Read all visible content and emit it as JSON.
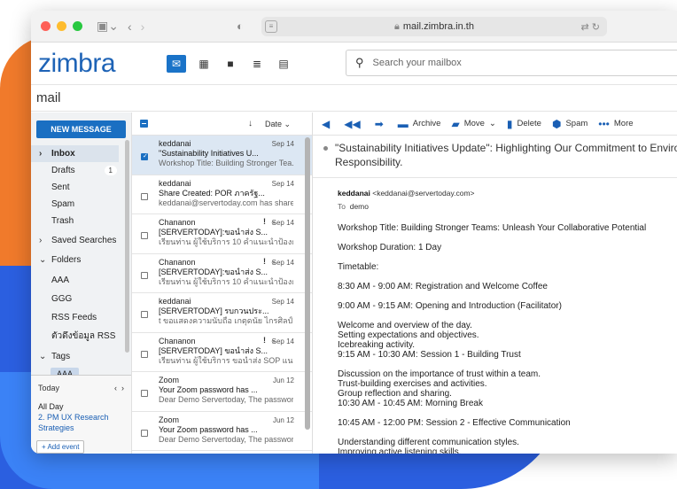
{
  "browser": {
    "url": "mail.zimbra.in.th"
  },
  "app": {
    "logo": "zimbra",
    "mode": "mail",
    "search_placeholder": "Search your mailbox"
  },
  "sidebar": {
    "new_message": "NEW MESSAGE",
    "inbox": "Inbox",
    "drafts": "Drafts",
    "drafts_count": "1",
    "sent": "Sent",
    "spam": "Spam",
    "trash": "Trash",
    "saved_searches": "Saved Searches",
    "folders": "Folders",
    "folder_items": [
      "AAA",
      "GGG",
      "RSS Feeds",
      "ตัวดึงข้อมูล RSS"
    ],
    "tags": "Tags",
    "tag_items": [
      "AAA"
    ]
  },
  "calendar": {
    "today": "Today",
    "all_day": "All Day",
    "event": "2. PM UX Research Strategies",
    "add_event": "+ Add event"
  },
  "list": {
    "sort_label": "Date",
    "messages": [
      {
        "from": "keddanai",
        "date": "Sep 14",
        "subject": "\"Sustainability Initiatives U...",
        "preview": "Workshop Title: Building Stronger Tea...",
        "selected": true,
        "flag": false
      },
      {
        "from": "keddanai",
        "date": "Sep 14",
        "subject": "Share Created: POR ภาครัฐ...",
        "preview": "keddanai@servertoday.com has share...",
        "selected": false,
        "flag": false
      },
      {
        "from": "Chananon",
        "date": "Sep 14",
        "subject": "[SERVERTODAY]:ขอนำส่ง S...",
        "preview": "เรียนท่าน ผู้ใช้บริการ 10 คำแนะนำป้องกัน...",
        "selected": false,
        "flag": true
      },
      {
        "from": "Chananon",
        "date": "Sep 14",
        "subject": "[SERVERTODAY]:ขอนำส่ง S...",
        "preview": "เรียนท่าน ผู้ใช้บริการ 10 คำแนะนำป้องกัน...",
        "selected": false,
        "flag": true
      },
      {
        "from": "keddanai",
        "date": "Sep 14",
        "subject": "[SERVERTODAY] รบกวนประ...",
        "preview": "t ขอแสดงความนับถือ เกตุดนัย ไกรศิลป์ ...",
        "selected": false,
        "flag": false
      },
      {
        "from": "Chananon",
        "date": "Sep 14",
        "subject": "[SERVERTODAY] ขอนำส่ง S...",
        "preview": "เรียนท่าน ผู้ใช้บริการ ขอนำส่ง SOP แนวท...",
        "selected": false,
        "flag": true
      },
      {
        "from": "Zoom",
        "date": "Jun 12",
        "subject": "Your Zoom password has ...",
        "preview": "Dear Demo Servertoday, The passwor...",
        "selected": false,
        "flag": false
      },
      {
        "from": "Zoom",
        "date": "Jun 12",
        "subject": "Your Zoom password has ...",
        "preview": "Dear Demo Servertoday, The passwor...",
        "selected": false,
        "flag": false
      }
    ]
  },
  "toolbar": {
    "archive": "Archive",
    "move": "Move",
    "delete": "Delete",
    "spam": "Spam",
    "more": "More"
  },
  "message": {
    "subject_line1": "\"Sustainability Initiatives Update\": Highlighting Our Commitment to Environm",
    "subject_line2": "Responsibility.",
    "sender_name": "keddanai",
    "sender_email": "<keddanai@servertoday.com>",
    "to_label": "To",
    "to_value": "demo",
    "paragraphs": [
      "Workshop Title: Building Stronger Teams: Unleash Your Collaborative Potential",
      "Workshop Duration: 1 Day",
      "Timetable:",
      "8:30 AM - 9:00 AM: Registration and Welcome Coffee",
      "9:00 AM - 9:15 AM: Opening and Introduction (Facilitator)",
      "Welcome and overview of the day.\nSetting expectations and objectives.\nIcebreaking activity.\n9:15 AM - 10:30 AM: Session 1 - Building Trust",
      "Discussion on the importance of trust within a team.\nTrust-building exercises and activities.\nGroup reflection and sharing.\n10:30 AM - 10:45 AM: Morning Break",
      "10:45 AM - 12:00 PM: Session 2 - Effective Communication",
      "Understanding different communication styles.\nImproving active listening skills."
    ]
  },
  "colors": {
    "brand": "#1e63b6",
    "accent": "#1a6fc2",
    "orange_bg": "#f07a2b",
    "blue_bg": "#2b5fe0"
  }
}
